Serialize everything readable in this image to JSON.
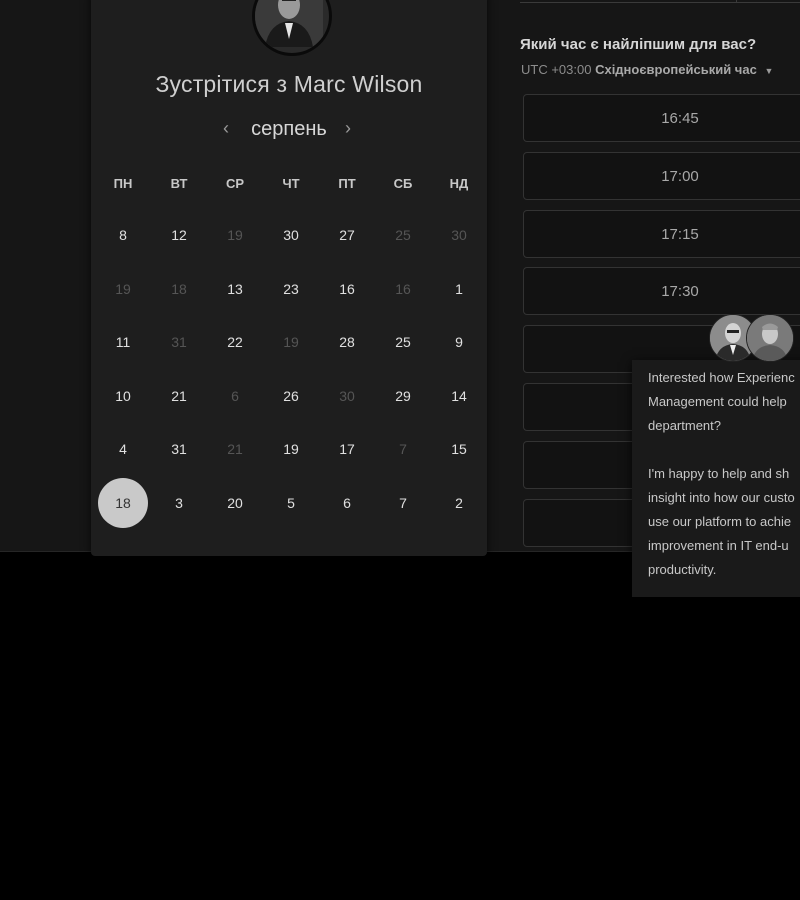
{
  "host": {
    "title": "Зустрітися з Marc Wilson",
    "avatar_icon": "person-avatar"
  },
  "calendar": {
    "month": "серпень",
    "prev_icon": "chevron-left-icon",
    "next_icon": "chevron-right-icon",
    "weekdays": [
      "ПН",
      "ВТ",
      "СР",
      "ЧТ",
      "ПТ",
      "СБ",
      "НД"
    ],
    "weeks": [
      [
        {
          "d": "8",
          "m": false
        },
        {
          "d": "12",
          "m": false
        },
        {
          "d": "19",
          "m": true
        },
        {
          "d": "30",
          "m": false
        },
        {
          "d": "27",
          "m": false
        },
        {
          "d": "25",
          "m": true
        },
        {
          "d": "30",
          "m": true
        }
      ],
      [
        {
          "d": "19",
          "m": true
        },
        {
          "d": "18",
          "m": true
        },
        {
          "d": "13",
          "m": false
        },
        {
          "d": "23",
          "m": false
        },
        {
          "d": "16",
          "m": false
        },
        {
          "d": "16",
          "m": true
        },
        {
          "d": "1",
          "m": false
        }
      ],
      [
        {
          "d": "11",
          "m": false
        },
        {
          "d": "31",
          "m": true
        },
        {
          "d": "22",
          "m": false
        },
        {
          "d": "19",
          "m": true
        },
        {
          "d": "28",
          "m": false
        },
        {
          "d": "25",
          "m": false
        },
        {
          "d": "9",
          "m": false
        }
      ],
      [
        {
          "d": "10",
          "m": false
        },
        {
          "d": "21",
          "m": false
        },
        {
          "d": "6",
          "m": true
        },
        {
          "d": "26",
          "m": false
        },
        {
          "d": "30",
          "m": true
        },
        {
          "d": "29",
          "m": false
        },
        {
          "d": "14",
          "m": false
        }
      ],
      [
        {
          "d": "4",
          "m": false
        },
        {
          "d": "31",
          "m": false
        },
        {
          "d": "21",
          "m": true
        },
        {
          "d": "19",
          "m": false
        },
        {
          "d": "17",
          "m": false
        },
        {
          "d": "7",
          "m": true
        },
        {
          "d": "15",
          "m": false
        }
      ],
      [
        {
          "d": "18",
          "m": false,
          "selected": true
        },
        {
          "d": "3",
          "m": false
        },
        {
          "d": "20",
          "m": false
        },
        {
          "d": "5",
          "m": false
        },
        {
          "d": "6",
          "m": false
        },
        {
          "d": "7",
          "m": false
        },
        {
          "d": "2",
          "m": false
        }
      ]
    ]
  },
  "schedule": {
    "question": "Який час є найліпшим для вас?",
    "tz_offset": "UTC +03:00",
    "tz_name": "Східноєвропейський час",
    "slots": [
      "16:45",
      "17:00",
      "17:15",
      "17:30",
      "",
      "",
      "",
      ""
    ]
  },
  "chat": {
    "paragraph1": [
      "Interested how Experienc",
      "Management could help",
      "department?"
    ],
    "paragraph2": [
      "I'm happy to help and sh",
      "insight into how our custo",
      "use our platform to achie",
      "improvement in IT end-u",
      "productivity."
    ]
  },
  "colors": {
    "background": "#000000",
    "card": "#1e1e1e",
    "selected_day": "#c9c9c9"
  }
}
